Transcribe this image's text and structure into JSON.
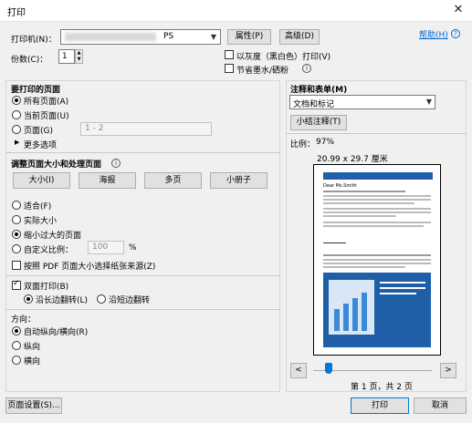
{
  "window": {
    "title": "打印",
    "close": "✕"
  },
  "printer": {
    "label": "打印机(N)：",
    "value": "PS",
    "properties_btn": "属性(P)",
    "advanced_btn": "高级(D)",
    "help_link": "帮助(H)",
    "help_icon": "question-icon"
  },
  "copies": {
    "label": "份数(C)：",
    "value": "1",
    "grayscale": "以灰度（黑白色）打印(V)",
    "save_ink": "节省墨水/硒粉"
  },
  "pages": {
    "heading": "要打印的页面",
    "all": "所有页面(A)",
    "current": "当前页面(U)",
    "range": "页面(G)",
    "range_placeholder": "1 - 2",
    "more": "更多选项"
  },
  "sizing": {
    "heading": "调整页面大小和处理页面",
    "tabs": [
      "大小(I)",
      "海报",
      "多页",
      "小册子"
    ],
    "fit": "适合(F)",
    "actual": "实际大小",
    "shrink": "缩小过大的页面",
    "custom": "自定义比例：",
    "custom_value": "100",
    "percent": "%",
    "pdf_source": "按照 PDF 页面大小选择纸张来源(Z)"
  },
  "duplex": {
    "label": "双面打印(B)",
    "long_edge": "沿长边翻转(L)",
    "short_edge": "沿短边翻转"
  },
  "orientation": {
    "label": "方向：",
    "auto": "自动纵向/横向(R)",
    "portrait": "纵向",
    "landscape": "横向"
  },
  "comments": {
    "heading": "注释和表单(M)",
    "value": "文档和标记",
    "summarize_btn": "小结注释(T)"
  },
  "preview": {
    "scale_label": "比例：",
    "scale_value": "97%",
    "paper_size": "20.99 x 29.7 厘米",
    "page_info": "第 1 页，共 2 页",
    "prev": "<",
    "next": ">",
    "doc_header": "Dear Ms.Smith"
  },
  "footer": {
    "page_setup": "页面设置(S)...",
    "print": "打印",
    "cancel": "取消"
  },
  "colors": {
    "accent": "#0078d7",
    "link": "#0066cc",
    "preview_blue": "#1f5fa8"
  }
}
